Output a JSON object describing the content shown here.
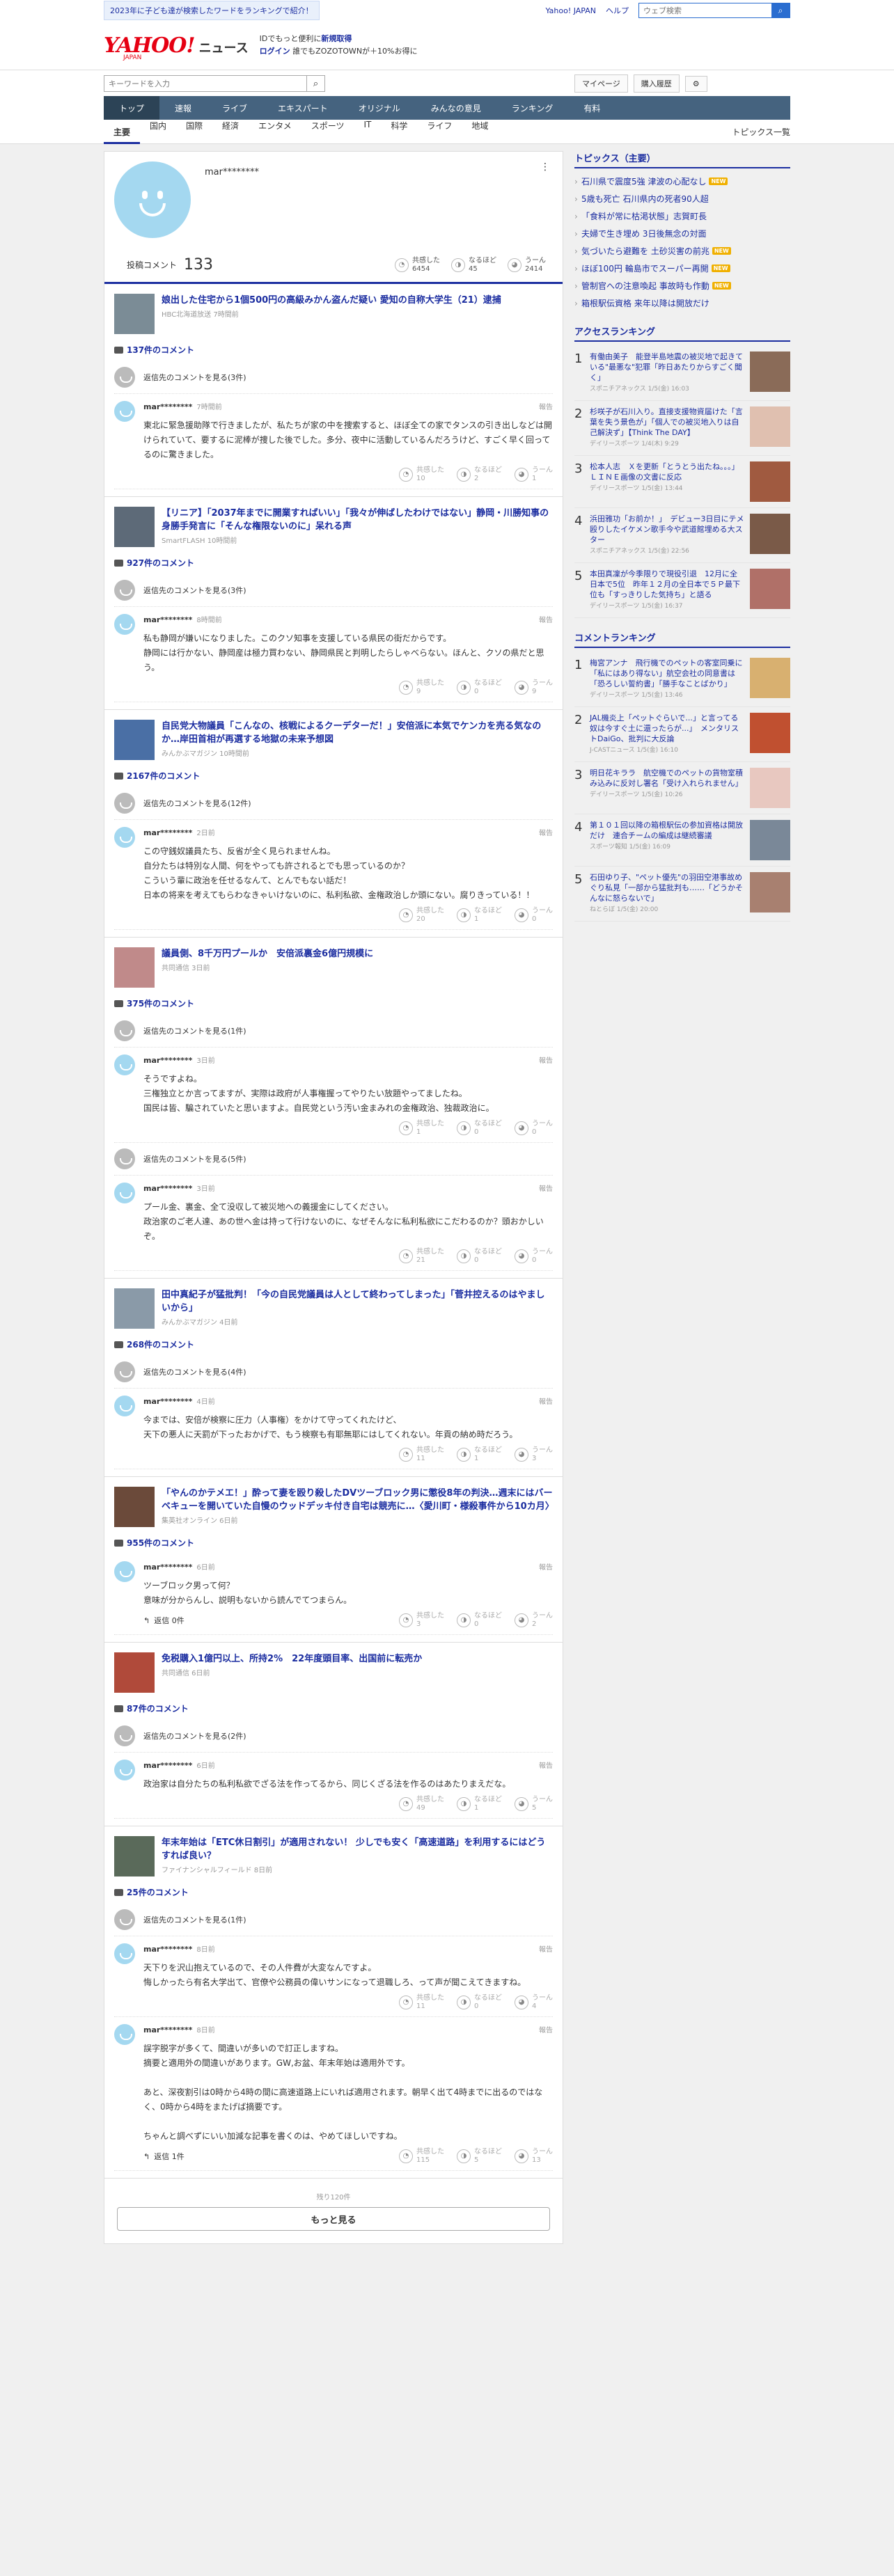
{
  "topbar": {
    "notice": "2023年に子ども達が検索したワードをランキングで紹介！",
    "links": [
      "Yahoo! JAPAN",
      "ヘルプ"
    ],
    "search_placeholder": "ウェブ検索"
  },
  "header": {
    "logo": "YAHOO!",
    "logo_jp": "JAPAN",
    "logo_news": "ニュース",
    "promo_line1": "IDでもっと便利に",
    "promo_new": "新規取得",
    "promo_login": "ログイン",
    "promo_line2": "誰でもZOZOTOWNが＋10%お得に"
  },
  "subheader": {
    "keyword_placeholder": "キーワードを入力",
    "mypage": "マイページ",
    "history": "購入履歴"
  },
  "nav1": [
    "トップ",
    "速報",
    "ライブ",
    "エキスパート",
    "オリジナル",
    "みんなの意見",
    "ランキング",
    "有料"
  ],
  "nav2": [
    "主要",
    "国内",
    "国際",
    "経済",
    "エンタメ",
    "スポーツ",
    "IT",
    "科学",
    "ライフ",
    "地域"
  ],
  "nav2_more": "トピックス一覧",
  "profile": {
    "name": "mar********",
    "comment_label": "投稿コメント",
    "comment_count": "133",
    "reactions": [
      {
        "label": "共感した",
        "value": "6454"
      },
      {
        "label": "なるほど",
        "value": "45"
      },
      {
        "label": "うーん",
        "value": "2414"
      }
    ]
  },
  "reply_more_label": "返信先のコメントを見る",
  "reaction_labels": [
    "共感した",
    "なるほど",
    "うーん"
  ],
  "report_label": "報告",
  "articles": [
    {
      "title": "娘出した住宅から1個500円の高級みかん盗んだ疑い 愛知の自称大学生（21）逮捕",
      "source": "HBC北海道放送 7時間前",
      "count": "137件のコメント",
      "thumb_color": "#7b8c96",
      "comments": [
        {
          "reply_count": "返信先のコメントを見る(3件)",
          "user": "mar********",
          "time": "7時間前",
          "text": "東北に緊急援助隊で行きましたが、私たちが家の中を捜索すると、ほぼ全ての家でタンスの引き出しなどは開けられていて、要するに泥棒が捜した後でした。多分、夜中に活動しているんだろうけど、すごく早く回ってるのに驚きました。",
          "r": [
            "10",
            "2",
            "1"
          ]
        }
      ]
    },
    {
      "title": "【リニア】「2037年までに開業すればいい」「我々が伸ばしたわけではない」静岡・川勝知事の身勝手発言に「そんな権限ないのに」呆れる声",
      "source": "SmartFLASH 10時間前",
      "count": "927件のコメント",
      "thumb_color": "#5d6a78",
      "comments": [
        {
          "reply_count": "返信先のコメントを見る(3件)",
          "user": "mar********",
          "time": "8時間前",
          "text": "私も静岡が嫌いになりました。このクソ知事を支援している県民の街だからです。\n静岡には行かない、静岡産は極力買わない、静岡県民と判明したらしゃべらない。ほんと、クソの県だと思う。",
          "r": [
            "9",
            "0",
            "9"
          ]
        }
      ]
    },
    {
      "title": "自民党大物議員「こんなの、核戦によるクーデターだ！」安倍派に本気でケンカを売る気なのか…岸田首相が再選する地獄の未来予想図",
      "source": "みんかぶマガジン 10時間前",
      "count": "2167件のコメント",
      "thumb_color": "#4a6fa5",
      "comments": [
        {
          "reply_count": "返信先のコメントを見る(12件)",
          "user": "mar********",
          "time": "2日前",
          "text": "この守銭奴議員たち、反省が全く見られませんね。\n自分たちは特別な人間、何をやっても許されるとでも思っているのか？\nこういう輩に政治を任せるなんて、とんでもない話だ！\n日本の将来を考えてもらわなきゃいけないのに、私利私欲、金権政治しか頭にない。腐りきっている！！",
          "r": [
            "20",
            "1",
            "0"
          ]
        }
      ]
    },
    {
      "title": "議員側、8千万円プールか　安倍派裏金6億円規模に",
      "source": "共同通信 3日前",
      "count": "375件のコメント",
      "thumb_color": "#c08a8a",
      "comments": [
        {
          "reply_count": "返信先のコメントを見る(1件)",
          "user": "mar********",
          "time": "3日前",
          "text": "そうですよね。\n三権独立とか言ってますが、実際は政府が人事権握ってやりたい放題やってましたね。\n国民は皆、騙されていたと思いますよ。自民党という汚い金まみれの金権政治、独裁政治に。",
          "r": [
            "1",
            "0",
            "0"
          ]
        },
        {
          "reply_count": "返信先のコメントを見る(5件)",
          "user": "mar********",
          "time": "3日前",
          "text": "プール金、裏金、全て没収して被災地への義援金にしてください。\n政治家のご老人達、あの世へ金は持って行けないのに、なぜそんなに私利私欲にこだわるのか？頭おかしいぞ。",
          "r": [
            "21",
            "0",
            "0"
          ]
        }
      ]
    },
    {
      "title": "田中真紀子が猛批判！「今の自民党議員は人として終わってしまった」「菅井控えるのはやましいから」",
      "source": "みんかぶマガジン 4日前",
      "count": "268件のコメント",
      "thumb_color": "#8a9aa8",
      "comments": [
        {
          "reply_count": "返信先のコメントを見る(4件)",
          "user": "mar********",
          "time": "4日前",
          "text": "今までは、安倍が検察に圧力（人事権）をかけて守ってくれたけど、\n天下の悪人に天罰が下ったおかげで、もう検察も有耶無耶にはしてくれない。年貢の納め時だろう。",
          "r": [
            "11",
            "1",
            "3"
          ]
        }
      ]
    },
    {
      "title": "「やんのかテメエ！」酔って妻を殴り殺したDVツーブロック男に懲役8年の判決…週末にはバーベキューを開いていた自慢のウッドデッキ付き自宅は競売に…〈愛川町・様殺事件から10カ月〉",
      "source": "集英社オンライン 6日前",
      "count": "955件のコメント",
      "thumb_color": "#6b4a3a",
      "comments": [
        {
          "reply_count": "",
          "user": "mar********",
          "time": "6日前",
          "text": "ツーブロック男って何？\n意味が分からんし、説明もないから読んでてつまらん。",
          "r": [
            "3",
            "0",
            "2"
          ],
          "reply_btn": "返信 0件"
        }
      ]
    },
    {
      "title": "免税購入1億円以上、所持2%　22年度頭目率、出国前に転売か",
      "source": "共同通信 6日前",
      "count": "87件のコメント",
      "thumb_color": "#b04a3a",
      "comments": [
        {
          "reply_count": "返信先のコメントを見る(2件)",
          "user": "mar********",
          "time": "6日前",
          "text": "政治家は自分たちの私利私欲でざる法を作ってるから、同じくざる法を作るのはあたりまえだな。",
          "r": [
            "49",
            "1",
            "5"
          ]
        }
      ]
    },
    {
      "title": "年末年始は「ETC休日割引」が適用されない！ 少しでも安く「高速道路」を利用するにはどうすれば良い？",
      "source": "ファイナンシャルフィールド 8日前",
      "count": "25件のコメント",
      "thumb_color": "#5a6a5a",
      "comments": [
        {
          "reply_count": "返信先のコメントを見る(1件)",
          "user": "mar********",
          "time": "8日前",
          "text": "天下りを沢山抱えているので、その人件費が大変なんですよ。\n悔しかったら有名大学出て、官僚や公務員の偉いサンになって退職しろ、って声が聞こえてきますね。",
          "r": [
            "11",
            "0",
            "4"
          ]
        },
        {
          "reply_count": "",
          "user": "mar********",
          "time": "8日前",
          "text": "誤字脱字が多くて、間違いが多いので訂正しますね。\n摘要と適用外の間違いがあります。GW,お盆、年末年始は適用外です。\n\nあと、深夜割引は0時から4時の間に高速道路上にいれば適用されます。朝早く出て4時までに出るのではなく、0時から4時をまたげば摘要です。\n\nちゃんと調べずにいい加減な記事を書くのは、やめてほしいですね。",
          "r": [
            "115",
            "5",
            "13"
          ],
          "reply_btn": "返信 1件"
        }
      ]
    }
  ],
  "footer": {
    "remaining": "残り120件",
    "more": "もっと見る"
  },
  "topics": {
    "title": "トピックス（主要）",
    "items": [
      {
        "t": "石川県で震度5強 津波の心配なし",
        "new": true
      },
      {
        "t": "5歳も死亡 石川県内の死者90人超",
        "new": false
      },
      {
        "t": "「食料が常に枯渇状態」志賀町長",
        "new": false
      },
      {
        "t": "夫婦で生き埋め 3日後無念の対面",
        "new": false
      },
      {
        "t": "気づいたら避難を 土砂災害の前兆",
        "new": true
      },
      {
        "t": "ほぼ100円 輪島市でスーパー再開",
        "new": true
      },
      {
        "t": "管制官への注意喚起 事故時も作動",
        "new": true
      },
      {
        "t": "箱根駅伝資格 来年以降は開放だけ",
        "new": false
      }
    ],
    "new_label": "NEW"
  },
  "access_ranking": {
    "title": "アクセスランキング",
    "items": [
      {
        "no": "1",
        "t": "有働由美子　能登半島地震の被災地で起きている\"最悪な\"犯罪「昨日あたりからすごく聞く」",
        "s": "スポニチアネックス 1/5(金) 16:03",
        "c": "#8a6b58"
      },
      {
        "no": "2",
        "t": "杉咲子が石川入り。直接支援物資届けた「言葉を失う景色が」「個人での被災地入りは自己解決ず」【Think The DAY】",
        "s": "デイリースポーツ 1/4(木) 9:29",
        "c": "#e0c0b0"
      },
      {
        "no": "3",
        "t": "松本人志　Ｘを更新「とうとう出たね。。。」ＬＩＮＥ画像の文書に反応",
        "s": "デイリースポーツ 1/5(金) 13:44",
        "c": "#a05a40"
      },
      {
        "no": "4",
        "t": "浜田雅功「お前か！」　デビュー3日目にテメ殴りしたイケメン歌手今や武道館埋める大スター",
        "s": "スポニチアネックス 1/5(金) 22:56",
        "c": "#7a5a48"
      },
      {
        "no": "5",
        "t": "本田真凜が今季限りで現役引退　12月に全日本で5位　昨年１２月の全日本で５Ｐ最下位も「すっきりした気持ち」と語る",
        "s": "デイリースポーツ 1/5(金) 16:37",
        "c": "#b07068"
      }
    ]
  },
  "comment_ranking": {
    "title": "コメントランキング",
    "items": [
      {
        "no": "1",
        "t": "梅宮アンナ　飛行機でのペットの客室同乗に「私にはあり得ない」航空会社の同意書は「恐ろしい誓約書」「勝手なことばかり」",
        "s": "デイリースポーツ 1/5(金) 13:46",
        "c": "#d8b070"
      },
      {
        "no": "2",
        "t": "JAL機炎上「ペットぐらいで...」と言ってる奴は今すぐ土に還ったらが...」　メンタリストDaiGo、批判に大反論",
        "s": "J-CASTニュース 1/5(金) 16:10",
        "c": "#c05030"
      },
      {
        "no": "3",
        "t": "明日花キララ　航空機でのペットの貨物室積み込みに反対し署名「受け入れられません」",
        "s": "デイリースポーツ 1/5(金) 10:26",
        "c": "#e8c8c0"
      },
      {
        "no": "4",
        "t": "第１０１回以降の箱根駅伝の参加資格は開放だけ　連合チームの編成は継続審議",
        "s": "スポーツ報知 1/5(金) 16:09",
        "c": "#7a8898"
      },
      {
        "no": "5",
        "t": "石田ゆり子、\"ペット優先\"の羽田空港事故めぐり私見「一部から猛批判も……「どうかそんなに怒らないで」",
        "s": "ねとらぼ 1/5(金) 20:00",
        "c": "#a88070"
      }
    ]
  }
}
